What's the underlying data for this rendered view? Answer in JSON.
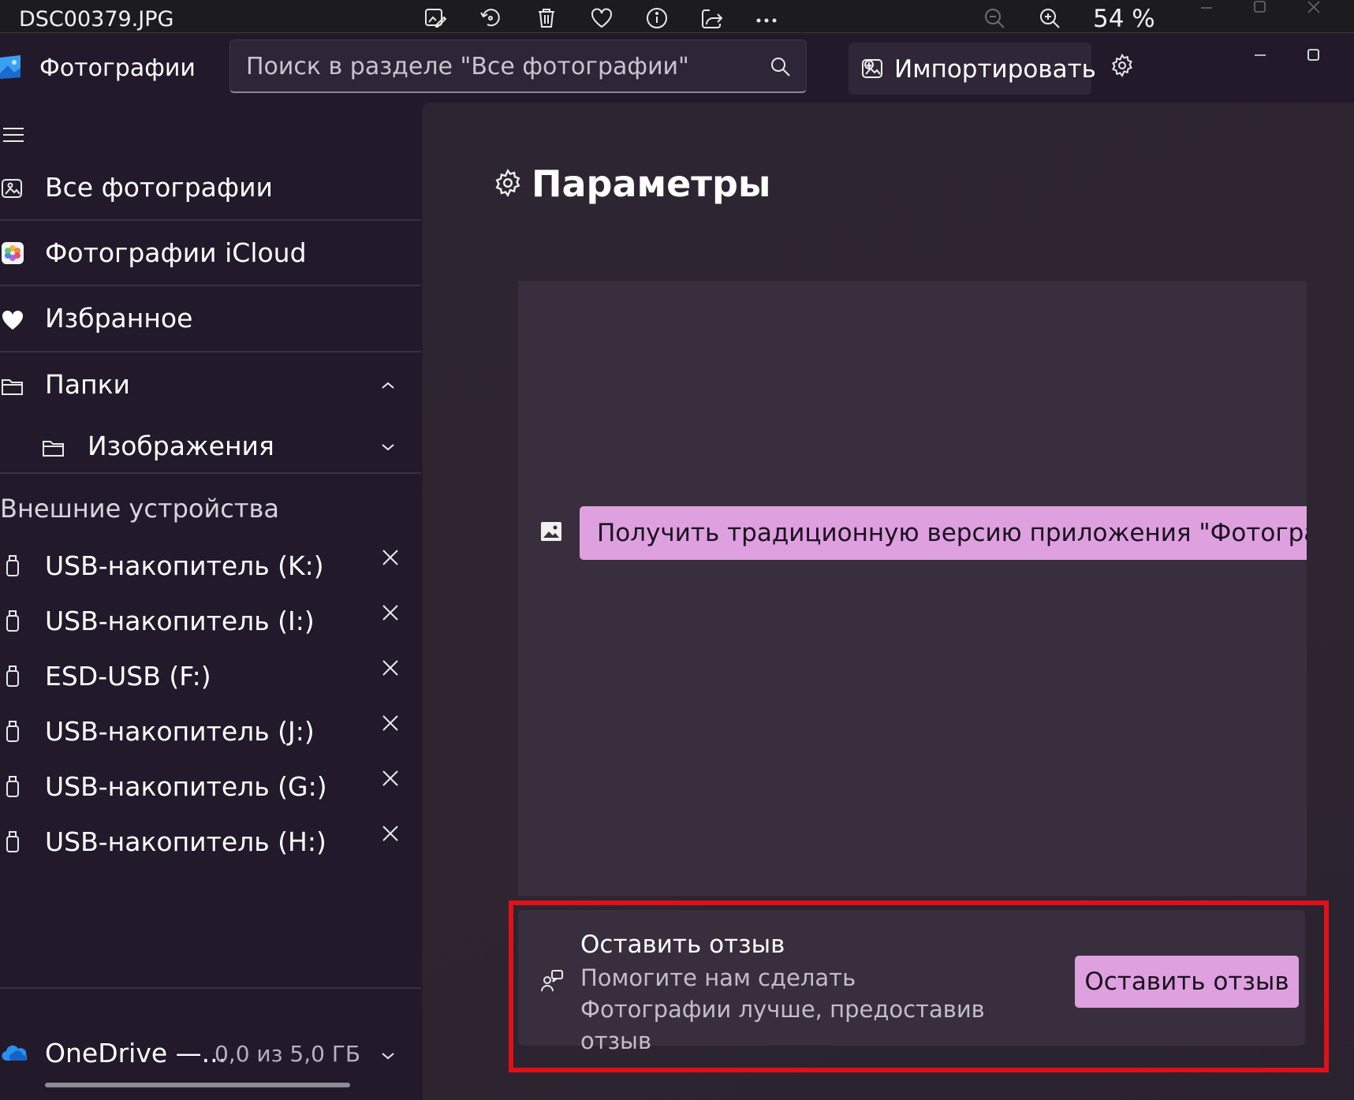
{
  "viewer_bar": {
    "file_name": "DSC00379.JPG",
    "zoom_label": "54 %"
  },
  "app": {
    "title": "Фотографии"
  },
  "search": {
    "placeholder": "Поиск в разделе \"Все фотографии\""
  },
  "header": {
    "import_label": "Импортировать"
  },
  "sidebar": {
    "nav": [
      {
        "label": "Все фотографии",
        "icon": "photos-icon"
      },
      {
        "label": "Фотографии iCloud",
        "icon": "icloud-photos-icon"
      },
      {
        "label": "Избранное",
        "icon": "heart-icon"
      },
      {
        "label": "Папки",
        "icon": "folder-icon"
      },
      {
        "label": "Изображения",
        "icon": "folder-icon"
      }
    ],
    "devices_title": "Внешние устройства",
    "devices": [
      {
        "label": "USB-накопитель (K:)"
      },
      {
        "label": "USB-накопитель (I:)"
      },
      {
        "label": "ESD-USB (F:)"
      },
      {
        "label": "USB-накопитель (J:)"
      },
      {
        "label": "USB-накопитель (G:)"
      },
      {
        "label": "USB-накопитель (H:)"
      }
    ],
    "onedrive": {
      "name": "OneDrive —...",
      "usage": "0,0 из 5,0 ГБ",
      "used_fraction": 0.0
    }
  },
  "main": {
    "page_title": "Параметры",
    "legacy_button_label": "Получить традиционную версию приложения \"Фотографии\"",
    "feedback": {
      "title": "Оставить отзыв",
      "description": "Помогите нам сделать Фотографии лучше, предоставив отзыв",
      "button_label": "Оставить отзыв"
    }
  },
  "colors": {
    "accent": "#dea0df",
    "background": "#221a2b",
    "card": "#382e3d",
    "highlight": "#e0101a"
  }
}
